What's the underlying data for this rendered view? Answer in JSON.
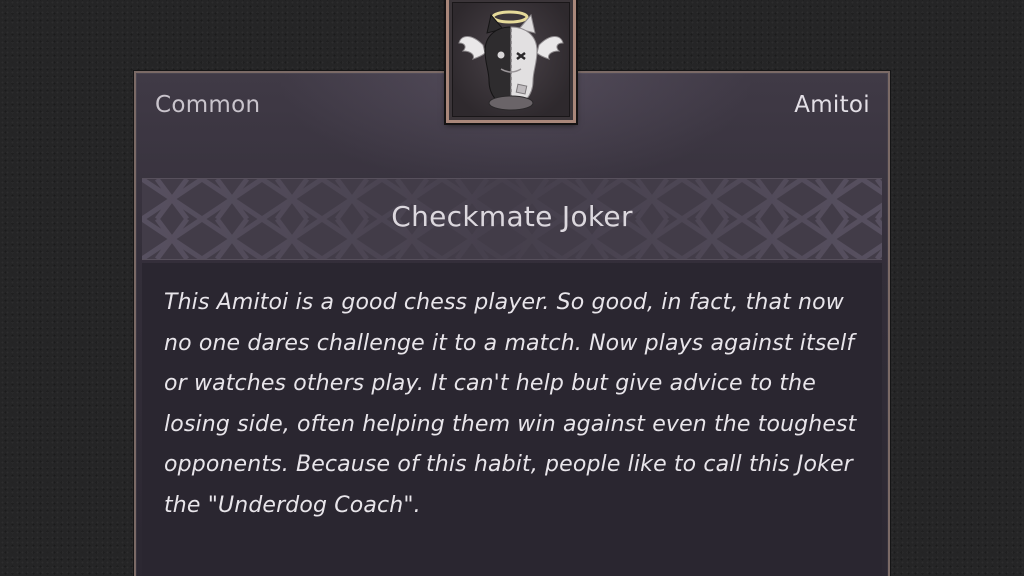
{
  "item": {
    "rarity": "Common",
    "category": "Amitoi",
    "name": "Checkmate Joker",
    "description": "This Amitoi is a good chess player. So good, in fact, that now no one dares challenge it to a match. Now plays against itself or watches others play. It can't help but give advice to the losing side, often helping them win against even the toughest opponents. Because of this habit, people like to call this Joker the \"Underdog Coach\".",
    "icon": "winged-halo-cat-plush-icon"
  },
  "colors": {
    "card_background": "#332e39",
    "frame_border": "#a9877a",
    "text_primary": "#e8e5ea"
  }
}
